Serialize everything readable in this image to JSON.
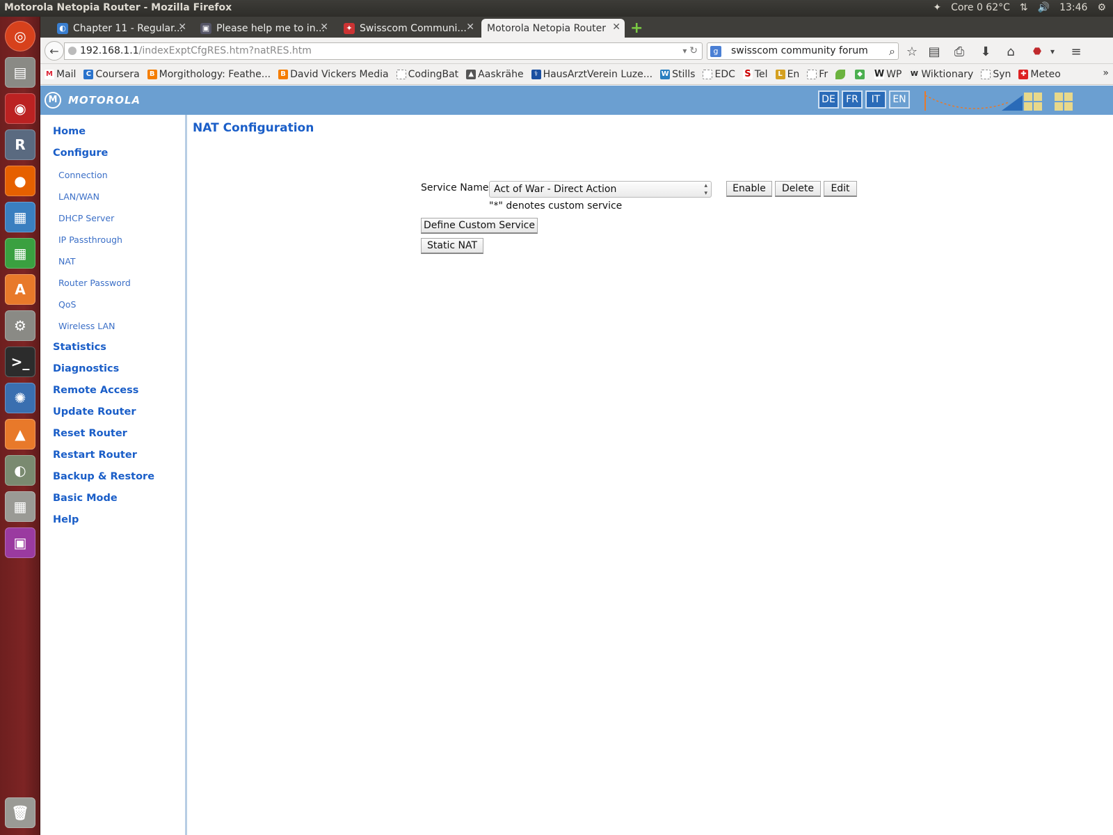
{
  "window_title": "Motorola Netopia Router - Mozilla Firefox",
  "indicators": {
    "temp": "Core 0 62°C",
    "time": "13:46"
  },
  "launcher_icons": [
    "ubuntu-dash",
    "files",
    "eye-of-gnome",
    "r-lang",
    "firefox",
    "libreoffice-writer",
    "libreoffice-calc",
    "software-center",
    "system-settings",
    "terminal",
    "network-app",
    "vlc",
    "disk-usage",
    "calculator",
    "workspace-switcher",
    "trash"
  ],
  "tabs": [
    {
      "label": "Chapter 11 - Regular...",
      "active": false
    },
    {
      "label": "Please help me to in...",
      "active": false
    },
    {
      "label": "Swisscom Communi...",
      "active": false
    },
    {
      "label": "Motorola Netopia Router",
      "active": true
    }
  ],
  "navbar": {
    "url_host": "192.168.1.1",
    "url_path": "/indexExptCfgRES.htm?natRES.htm",
    "search_value": "swisscom community forum"
  },
  "bookmarks": [
    "Mail",
    "Coursera",
    "Morgithology: Feathe...",
    "David Vickers Media",
    "CodingBat",
    "Aaskrähe",
    "HausArztVerein Luze...",
    "Stills",
    "EDC",
    "Tel",
    "En",
    "Fr",
    "",
    "",
    "WP",
    "Wiktionary",
    "Syn",
    "Meteo"
  ],
  "router": {
    "brand": "MOTOROLA",
    "languages": [
      "DE",
      "FR",
      "IT",
      "EN"
    ],
    "nav_main": [
      "Home",
      "Configure",
      "Statistics",
      "Diagnostics",
      "Remote Access",
      "Update Router",
      "Reset Router",
      "Restart Router",
      "Backup & Restore",
      "Basic Mode",
      "Help"
    ],
    "nav_sub": [
      "Connection",
      "LAN/WAN",
      "DHCP Server",
      "IP Passthrough",
      "NAT",
      "Router Password",
      "QoS",
      "Wireless LAN"
    ],
    "page_title": "NAT Configuration",
    "service_label": "Service Name",
    "service_selected": "Act of War - Direct Action",
    "buttons": {
      "enable": "Enable",
      "delete": "Delete",
      "edit": "Edit",
      "define_custom": "Define Custom Service",
      "static_nat": "Static NAT"
    },
    "custom_note": "\"*\" denotes custom service"
  },
  "colors": {
    "router_header": "#6b9fd1",
    "nav_link": "#1a5ec8",
    "launcher": "#7d2424"
  }
}
